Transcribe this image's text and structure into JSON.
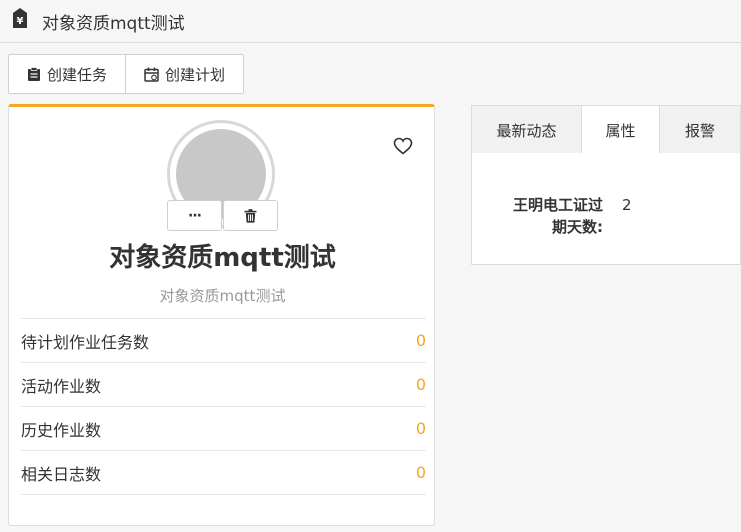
{
  "window": {
    "title": "对象资质mqtt测试",
    "icon": "yen-tag-icon"
  },
  "toolbar": {
    "create_task_label": "创建任务",
    "create_plan_label": "创建计划"
  },
  "card": {
    "title": "对象资质mqtt测试",
    "subtitle": "对象资质mqtt测试",
    "more_label": "···",
    "stats": [
      {
        "label": "待计划作业任务数",
        "value": "0"
      },
      {
        "label": "活动作业数",
        "value": "0"
      },
      {
        "label": "历史作业数",
        "value": "0"
      },
      {
        "label": "相关日志数",
        "value": "0"
      }
    ]
  },
  "tabs": [
    {
      "label": "最新动态",
      "active": false
    },
    {
      "label": "属性",
      "active": true
    },
    {
      "label": "报警",
      "active": false
    }
  ],
  "properties": {
    "label_line1": "王明电工证过",
    "label_line2": "期天数:",
    "value": "2"
  },
  "colors": {
    "accent": "#f5a623",
    "avatar": "#c8c8c8"
  }
}
